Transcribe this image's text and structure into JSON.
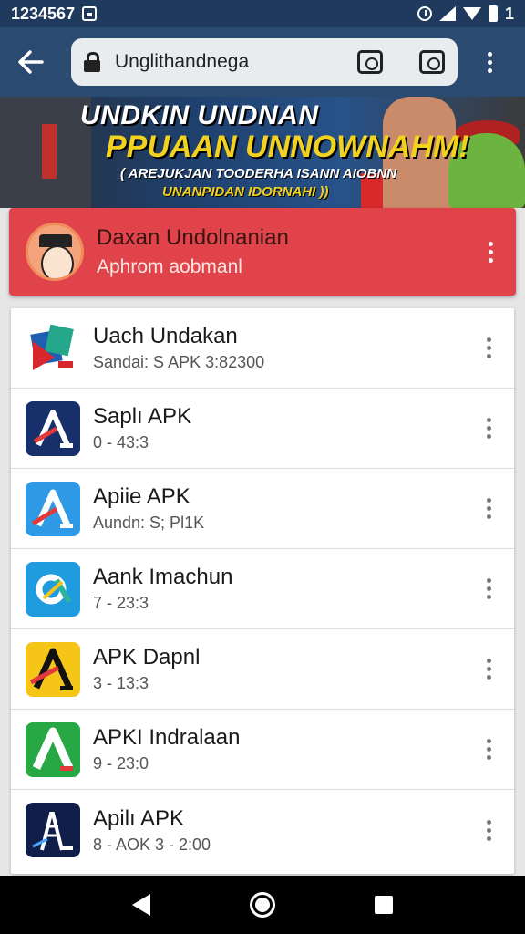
{
  "status_bar": {
    "time": "1234567",
    "icons": [
      "notification-icon",
      "alarm-icon",
      "signal-icon",
      "wifi-icon",
      "battery-icon"
    ],
    "battery_text": "1"
  },
  "toolbar": {
    "back_icon": "arrow-left-icon",
    "url": "Unglithandnega",
    "icons": [
      "lock-icon",
      "camera-icon",
      "camera-icon",
      "more-vert-icon"
    ]
  },
  "banner": {
    "title_line1": "UNDKIN UNDNAN",
    "title_line2": "PPUAAN UNNOWNAHM!",
    "subtitle_line1": "( AREJUKJAN TOODERHA ISANN AIOBNN",
    "subtitle_line2": "UNANPIDAN IDORNAHI ))"
  },
  "profile": {
    "name": "Daxan Undolnanian",
    "subtitle": "Aphrom aobmanl",
    "color": "#e0444a"
  },
  "apps": [
    {
      "name": "Uach Undakan",
      "meta": "Sandai: S APK 3:82300",
      "icon": "app-icon-blue-red"
    },
    {
      "name": "Saplı APK",
      "meta": "0 - 43:3",
      "icon": "app-icon-navy-a"
    },
    {
      "name": "Apiie APK",
      "meta": "Aundn: S; Pl1K",
      "icon": "app-icon-lightblue-a"
    },
    {
      "name": "Aank Imachun",
      "meta": "7 - 23:3",
      "icon": "app-icon-cyan-c"
    },
    {
      "name": "APK Dapnl",
      "meta": "3 - 13:3",
      "icon": "app-icon-yellow-a"
    },
    {
      "name": "APKI Indralaan",
      "meta": "9 - 23:0",
      "icon": "app-icon-green-a"
    },
    {
      "name": "Apilı APK",
      "meta": "8 - AOK 3 - 2:00",
      "icon": "app-icon-navy-tower"
    }
  ],
  "nav": {
    "back": "nav-back-icon",
    "home": "nav-home-icon",
    "recent": "nav-recent-icon"
  }
}
